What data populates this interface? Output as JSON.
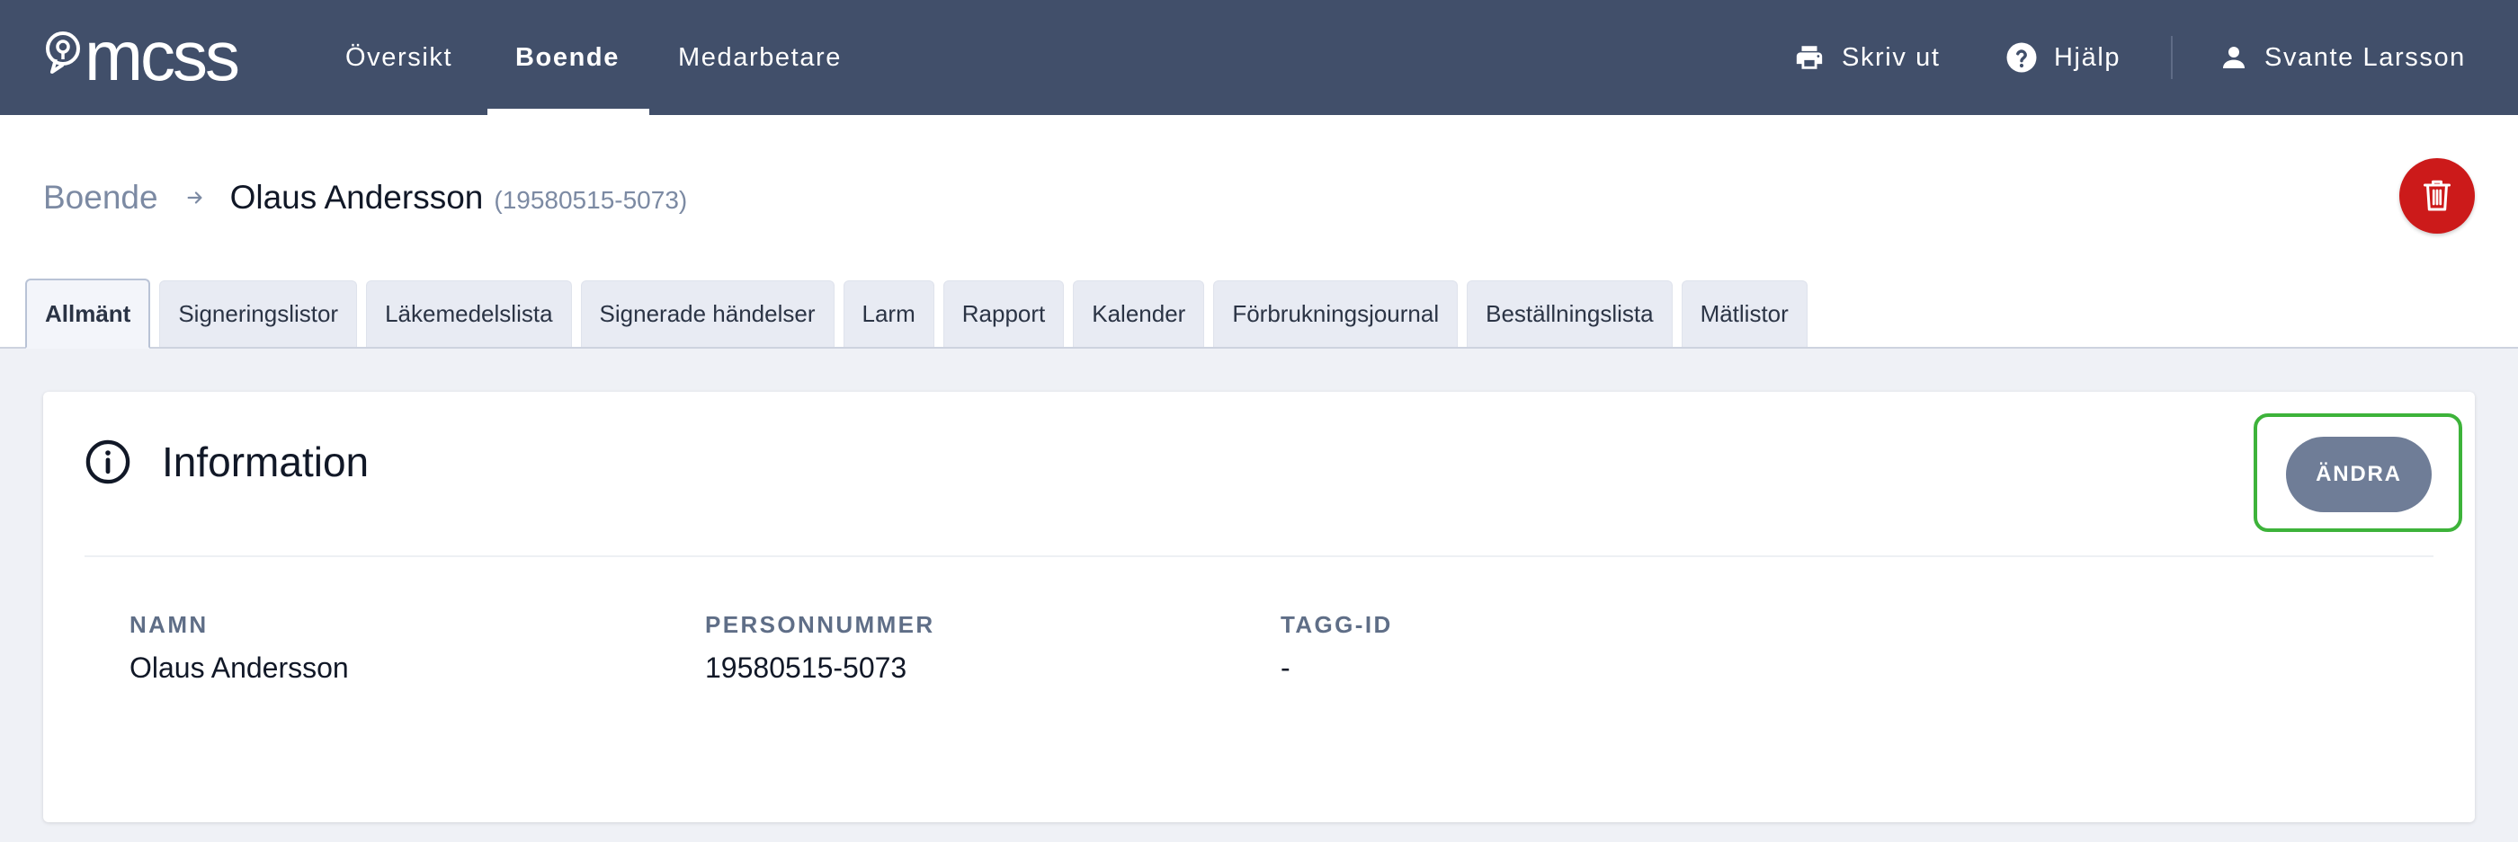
{
  "app": {
    "logo_text": "mcss"
  },
  "nav": {
    "items": [
      {
        "label": "Översikt",
        "active": false
      },
      {
        "label": "Boende",
        "active": true
      },
      {
        "label": "Medarbetare",
        "active": false
      }
    ],
    "print_label": "Skriv ut",
    "help_label": "Hjälp",
    "user_name": "Svante Larsson"
  },
  "breadcrumb": {
    "parent": "Boende",
    "name": "Olaus Andersson",
    "personnummer": "(19580515-5073)"
  },
  "tabs": [
    {
      "label": "Allmänt",
      "active": true
    },
    {
      "label": "Signeringslistor",
      "active": false
    },
    {
      "label": "Läkemedelslista",
      "active": false
    },
    {
      "label": "Signerade händelser",
      "active": false
    },
    {
      "label": "Larm",
      "active": false
    },
    {
      "label": "Rapport",
      "active": false
    },
    {
      "label": "Kalender",
      "active": false
    },
    {
      "label": "Förbrukningsjournal",
      "active": false
    },
    {
      "label": "Beställningslista",
      "active": false
    },
    {
      "label": "Mätlistor",
      "active": false
    }
  ],
  "card": {
    "title": "Information",
    "edit_label": "ÄNDRA",
    "fields": [
      {
        "label": "NAMN",
        "value": "Olaus Andersson"
      },
      {
        "label": "PERSONNUMMER",
        "value": "19580515-5073"
      },
      {
        "label": "TAGG-ID",
        "value": "-"
      }
    ]
  },
  "colors": {
    "navbar": "#414f6a",
    "delete": "#cc1a1a",
    "edit_button": "#6f7d97",
    "highlight": "#3db33a"
  }
}
